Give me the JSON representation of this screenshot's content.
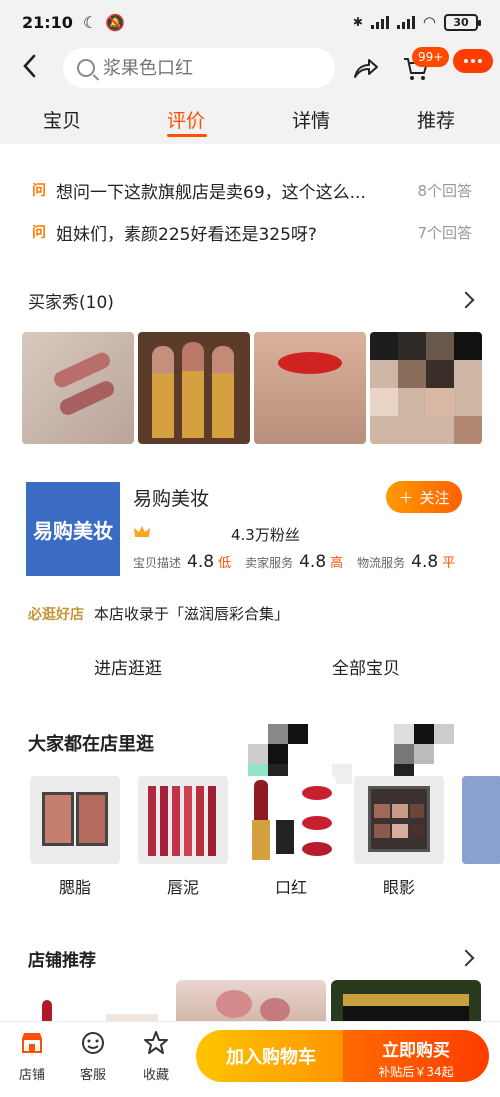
{
  "status_bar": {
    "time": "21:10",
    "battery": "30"
  },
  "header": {
    "search_placeholder": "浆果色口红",
    "cart_badge": "99+"
  },
  "tabs": [
    {
      "label": "宝贝"
    },
    {
      "label": "评价"
    },
    {
      "label": "详情"
    },
    {
      "label": "推荐"
    }
  ],
  "qa": [
    {
      "marker": "问",
      "question": "想问一下这款旗舰店是卖69，这个这么...",
      "answers": "8个回答"
    },
    {
      "marker": "问",
      "question": "姐妹们，素颜225好看还是325呀?",
      "answers": "7个回答"
    }
  ],
  "buyer_show": {
    "title": "买家秀(10)"
  },
  "shop": {
    "logo_text": "易购美妆",
    "name": "易购美妆",
    "follow_label": "关注",
    "fans": "4.3万粉丝",
    "ratings": [
      {
        "label": "宝贝描述",
        "value": "4.8",
        "tag": "低"
      },
      {
        "label": "卖家服务",
        "value": "4.8",
        "tag": "高"
      },
      {
        "label": "物流服务",
        "value": "4.8",
        "tag": "平"
      }
    ],
    "must_visit": "必逛好店",
    "collection": "本店收录于「滋润唇彩合集」",
    "enter_shop": "进店逛逛",
    "all_items": "全部宝贝"
  },
  "browse": {
    "title": "大家都在店里逛",
    "categories": [
      {
        "label": "腮脂"
      },
      {
        "label": "唇泥"
      },
      {
        "label": "口红"
      },
      {
        "label": "眼影"
      }
    ]
  },
  "store_recommend": {
    "title": "店铺推荐"
  },
  "bottom_bar": {
    "shop": "店铺",
    "service": "客服",
    "favorite": "收藏",
    "add_to_cart": "加入购物车",
    "buy_now": "立即购买",
    "buy_now_sub": "补贴后￥34起"
  },
  "colors": {
    "accent": "#ff5000",
    "cart_gradient": "#ffb000",
    "buy_gradient": "#ff4a00",
    "shop_logo": "#3a6cc3"
  }
}
